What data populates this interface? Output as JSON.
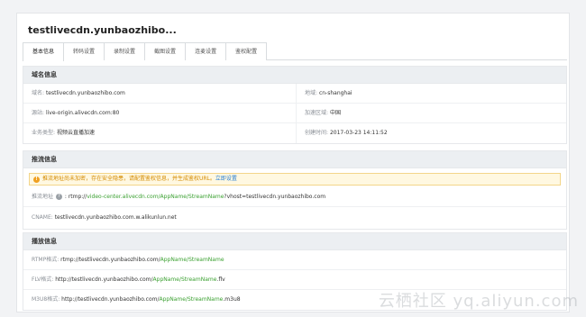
{
  "page": {
    "title": "testlivecdn.yunbaozhibo...",
    "tabs": [
      "基本信息",
      "转码设置",
      "录制设置",
      "截图设置",
      "连麦设置",
      "鉴权配置"
    ]
  },
  "basic": {
    "heading": "域名信息",
    "domain_label": "域名:",
    "domain_value": "testlivecdn.yunbaozhibo.com",
    "region_label": "地域:",
    "region_value": "cn-shanghai",
    "origin_label": "源站:",
    "origin_value": "live-origin.alivecdn.com:80",
    "accel_label": "加速区域:",
    "accel_value": "中国",
    "biz_label": "业务类型:",
    "biz_value": "视频云直播加速",
    "created_label": "创建时间:",
    "created_value": "2017-03-23 14:11:52"
  },
  "push": {
    "heading": "推流信息",
    "notice_text": "推流地址尚未加密，存在安全隐患，请配置鉴权信息，并生成鉴权URL。",
    "notice_link": "立即设置",
    "addr_label": "推流地址",
    "addr_prefix": ": rtmp://",
    "addr_green": "video-center.alivecdn.com/AppName/StreamName",
    "addr_suffix": "?vhost=testlivecdn.yunbaozhibo.com",
    "cname_label": "CNAME:",
    "cname_value": "testlivecdn.yunbaozhibo.com.w.alikunlun.net"
  },
  "play": {
    "heading": "播放信息",
    "rtmp_label": "RTMP格式:",
    "rtmp_prefix": "rtmp://testlivecdn.yunbaozhibo.com/",
    "rtmp_green": "AppName/StreamName",
    "rtmp_suffix": "",
    "flv_label": "FLV格式:",
    "flv_prefix": "http://testlivecdn.yunbaozhibo.com/",
    "flv_green": "AppName/StreamName",
    "flv_suffix": ".flv",
    "m3u8_label": "M3U8格式:",
    "m3u8_prefix": "http://testlivecdn.yunbaozhibo.com/",
    "m3u8_green": "AppName/StreamName",
    "m3u8_suffix": ".m3u8"
  },
  "watermark": "云栖社区 yq.aliyun.com",
  "icons": {
    "notice": "warning-icon",
    "help": "help-icon"
  },
  "colors": {
    "accent_green": "#3aa030",
    "link_blue": "#2a7fd4",
    "warning": "#f0a020"
  }
}
